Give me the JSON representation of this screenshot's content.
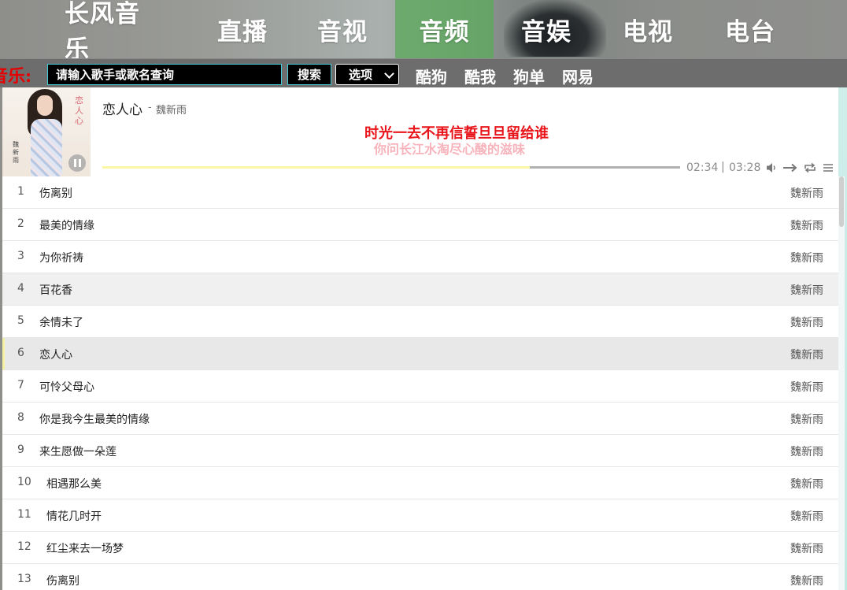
{
  "nav": {
    "items": [
      {
        "label": "长风音乐",
        "active": false
      },
      {
        "label": "直播",
        "active": false
      },
      {
        "label": "音视",
        "active": false
      },
      {
        "label": "音频",
        "active": true
      },
      {
        "label": "音娱",
        "active": false
      },
      {
        "label": "电视",
        "active": false
      },
      {
        "label": "电台",
        "active": false
      }
    ]
  },
  "search": {
    "label": "音乐:",
    "placeholder": "请输入歌手或歌名查询",
    "button": "搜索",
    "select_value": "选项",
    "sources": [
      "酷狗",
      "酷我",
      "狗单",
      "网易"
    ]
  },
  "player": {
    "title": "恋人心",
    "separator": "-",
    "artist": "魏新雨",
    "lyric_current": "时光一去不再信誓旦旦留给谁",
    "lyric_next": "你问长江水淘尽心酸的滋味",
    "time_current": "02:34",
    "time_separator": "|",
    "time_total": "03:28",
    "progress_fraction": 0.74,
    "cover_script": "恋人心",
    "cover_artist_mark": "魏新雨",
    "icons": [
      "pause-icon",
      "volume-icon",
      "play-order-icon",
      "loop-icon",
      "playlist-menu-icon"
    ]
  },
  "playlist": {
    "songs": [
      {
        "num": "1",
        "title": "伤离别",
        "artist": "魏新雨"
      },
      {
        "num": "2",
        "title": "最美的情缘",
        "artist": "魏新雨"
      },
      {
        "num": "3",
        "title": "为你祈祷",
        "artist": "魏新雨"
      },
      {
        "num": "4",
        "title": "百花香",
        "artist": "魏新雨"
      },
      {
        "num": "5",
        "title": "余情未了",
        "artist": "魏新雨"
      },
      {
        "num": "6",
        "title": "恋人心",
        "artist": "魏新雨"
      },
      {
        "num": "7",
        "title": "可怜父母心",
        "artist": "魏新雨"
      },
      {
        "num": "8",
        "title": "你是我今生最美的情缘",
        "artist": "魏新雨"
      },
      {
        "num": "9",
        "title": "来生愿做一朵莲",
        "artist": "魏新雨"
      },
      {
        "num": "10",
        "title": "相遇那么美",
        "artist": "魏新雨"
      },
      {
        "num": "11",
        "title": "情花几时开",
        "artist": "魏新雨"
      },
      {
        "num": "12",
        "title": "红尘来去一场梦",
        "artist": "魏新雨"
      },
      {
        "num": "13",
        "title": "伤离别",
        "artist": "魏新雨"
      }
    ],
    "hover_index": 3,
    "current_index": 5
  },
  "colors": {
    "nav_active": "#5caa5c",
    "search_border": "#41d0d7",
    "search_label": "#e60000",
    "lyric_current": "#e8141a",
    "lyric_next": "#f7b3bb",
    "progress_fill": "#fbf7a5"
  }
}
